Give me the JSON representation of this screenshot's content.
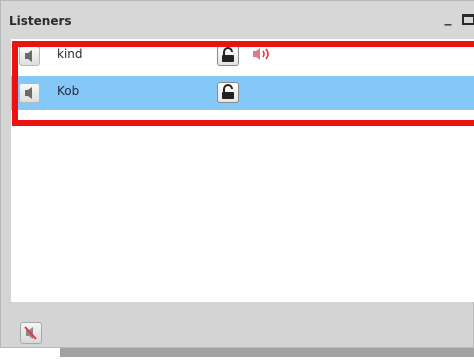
{
  "window": {
    "title": "Listeners"
  },
  "listeners": [
    {
      "name": "kind",
      "selected": false,
      "speaker_icon": "speaker-icon",
      "lock_icon": "unlock-icon",
      "status_icon": "volume-active-icon"
    },
    {
      "name": "Kob",
      "selected": true,
      "speaker_icon": "speaker-icon",
      "lock_icon": "unlock-icon",
      "status_icon": null
    }
  ],
  "footer": {
    "mute_icon": "speaker-muted-icon"
  },
  "colors": {
    "selection": "#84c8f7",
    "highlight": "#ee1111",
    "panel": "#d4d4d4"
  }
}
